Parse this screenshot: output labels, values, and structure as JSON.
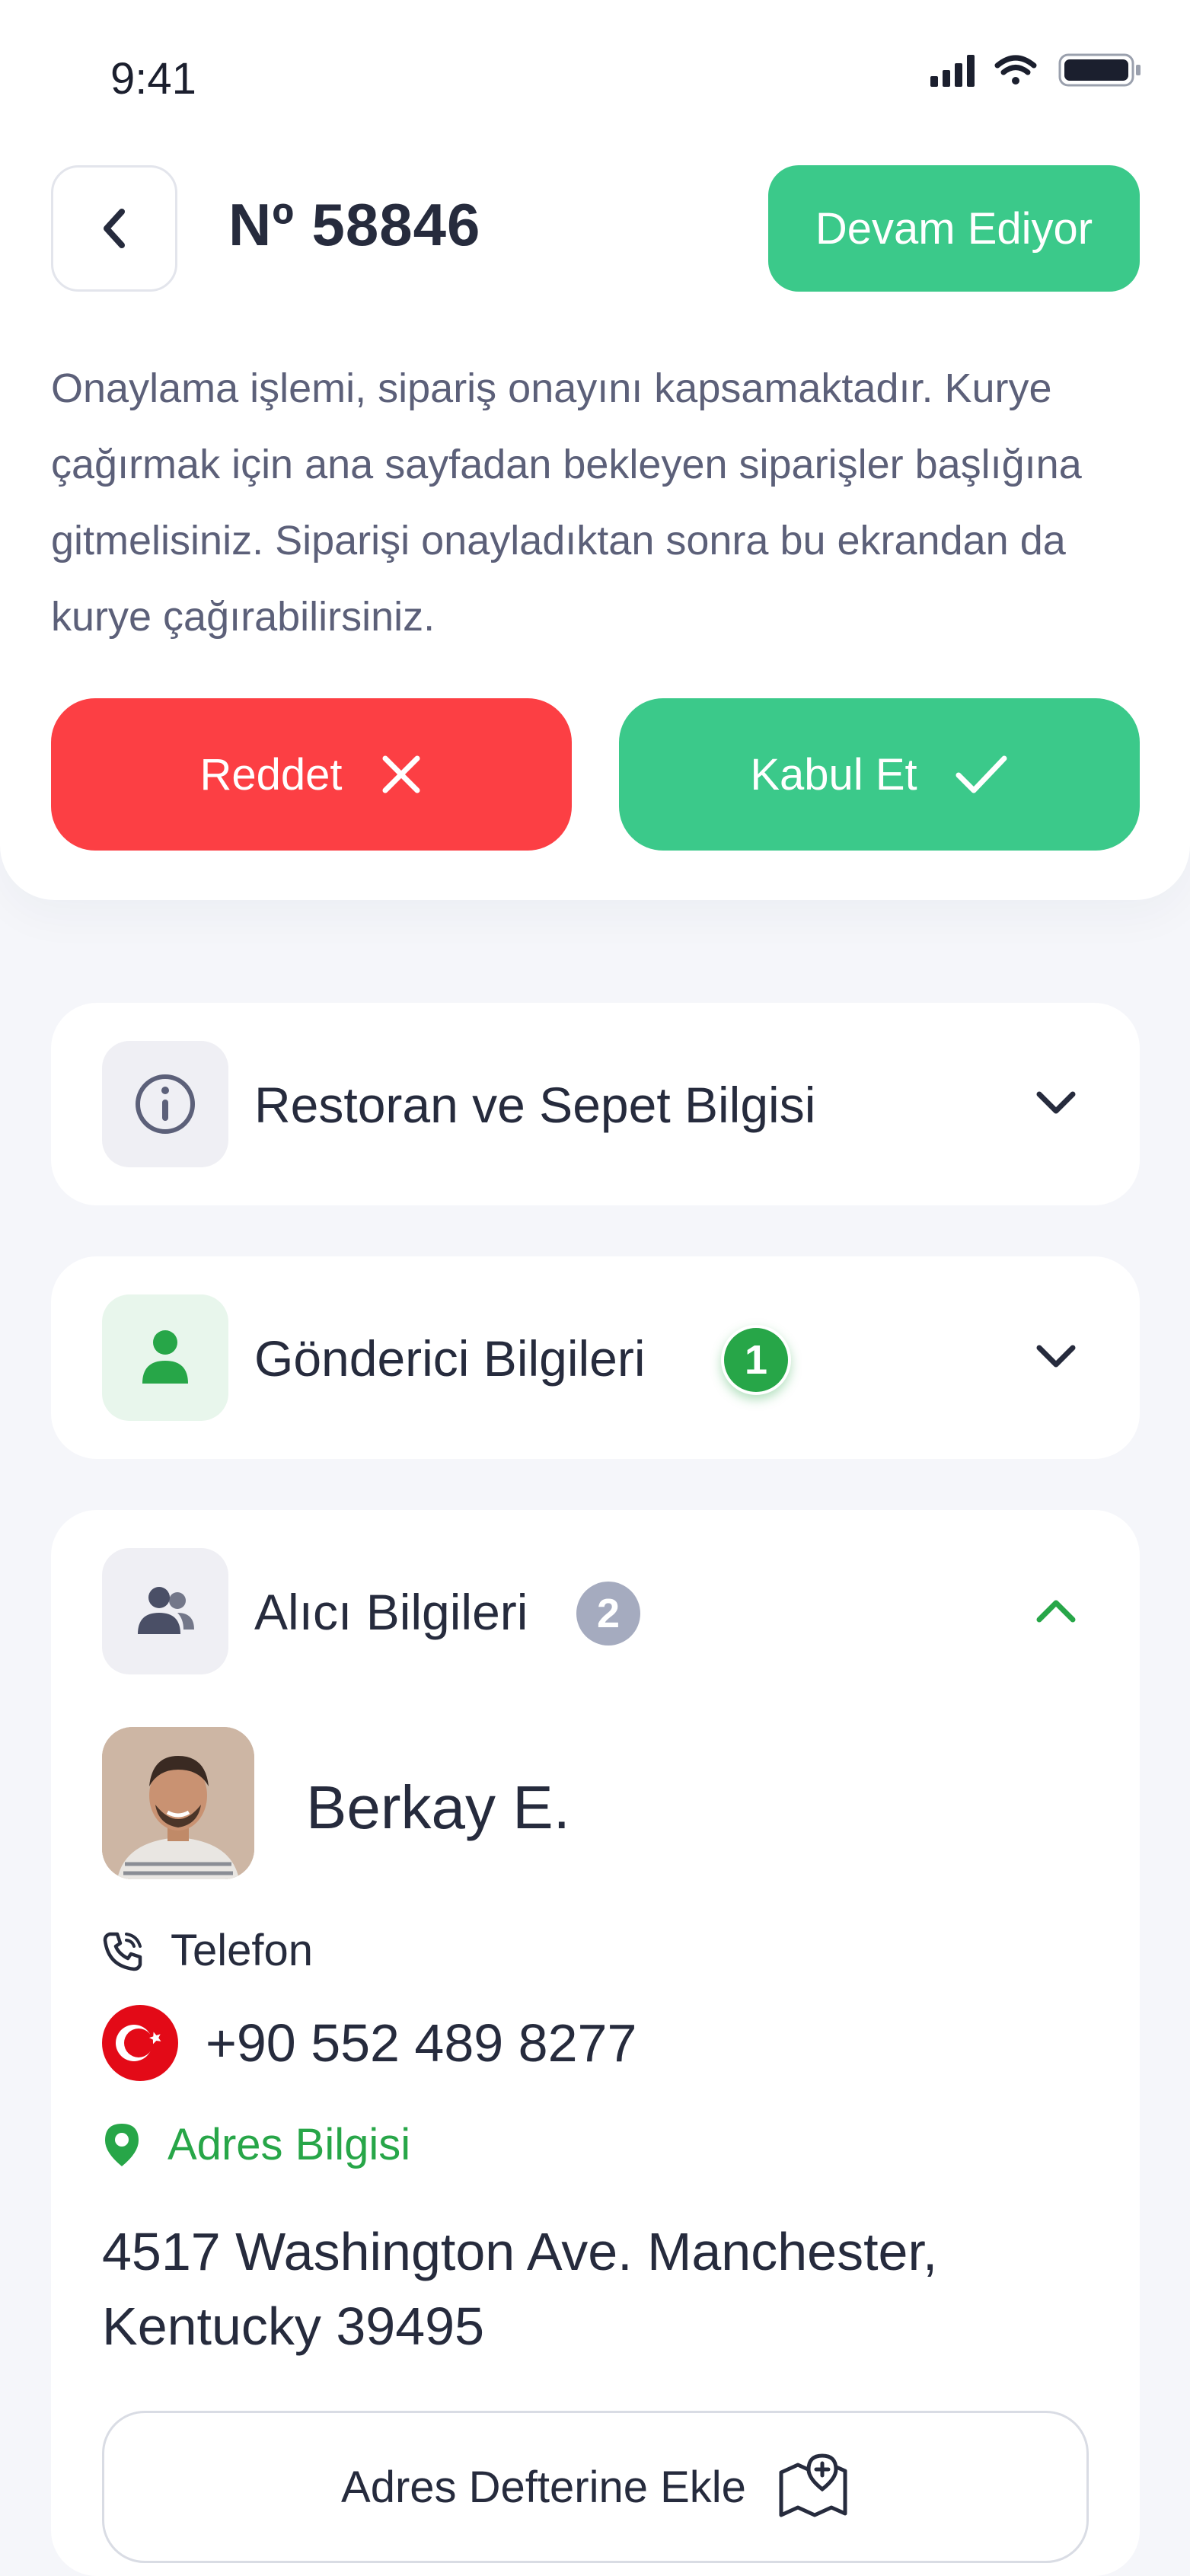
{
  "status_bar": {
    "time": "9:41"
  },
  "header": {
    "order_number": "Nº 58846",
    "status": "Devam Ediyor"
  },
  "info": {
    "text": "Onaylama işlemi, sipariş onayını kapsamaktadır. Kurye çağırmak için ana sayfadan bekleyen siparişler başlığına gitmelisiniz. Siparişi onayladıktan sonra bu ekrandan da kurye çağırabilirsiniz."
  },
  "actions": {
    "reject_label": "Reddet",
    "accept_label": "Kabul Et"
  },
  "sections": {
    "restaurant": {
      "title": "Restoran ve Sepet Bilgisi",
      "expanded": false
    },
    "sender": {
      "title": "Gönderici Bilgileri",
      "badge": "1",
      "expanded": false
    },
    "recipient": {
      "title": "Alıcı Bilgileri",
      "badge": "2",
      "expanded": true
    }
  },
  "recipient": {
    "name": "Berkay E.",
    "phone_label": "Telefon",
    "phone": "+90 552 489 8277",
    "address_label": "Adres Bilgisi",
    "address": "4517 Washington Ave. Manchester, Kentucky 39495",
    "add_to_address_book": "Adres Defterine Ekle"
  },
  "colors": {
    "accent_green": "#3bc98a",
    "reject_red": "#fc3f44",
    "sender_badge": "#27a648",
    "recipient_badge": "#a5abbf",
    "address_label": "#27a648"
  }
}
